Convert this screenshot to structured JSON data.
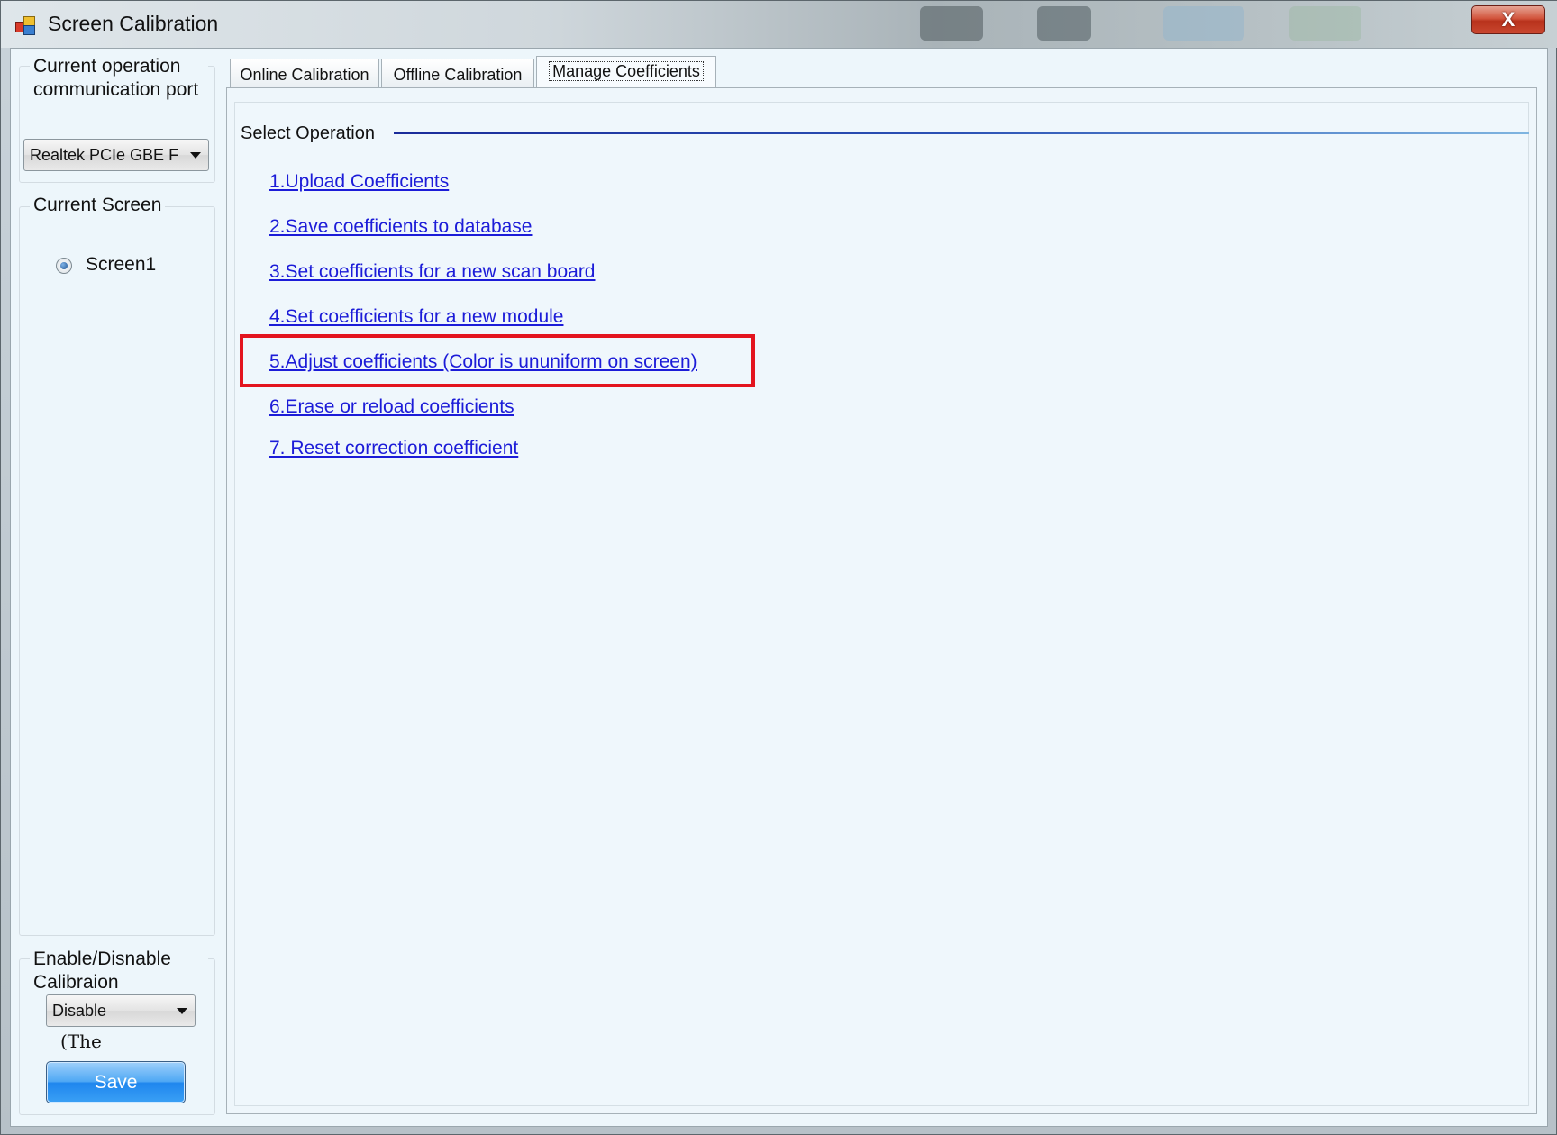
{
  "window": {
    "title": "Screen Calibration",
    "close_label": "X"
  },
  "sidebar": {
    "port_group_title": "Current operation communication port",
    "port_selected": "Realtek PCIe GBE F",
    "screen_group_title": "Current Screen",
    "screens": [
      {
        "label": "Screen1",
        "selected": true
      }
    ],
    "calibration_group_title": "Enable/Disnable Calibraion",
    "calibration_selected": "Disable",
    "note_text": "(The",
    "save_label": "Save"
  },
  "tabs": [
    {
      "label": "Online Calibration",
      "active": false
    },
    {
      "label": "Offline Calibration",
      "active": false
    },
    {
      "label": "Manage Coefficients",
      "active": true
    }
  ],
  "main": {
    "section_title": "Select Operation",
    "operations": [
      {
        "label": "1.Upload Coefficients"
      },
      {
        "label": "2.Save coefficients to database"
      },
      {
        "label": "3.Set coefficients for a new scan board"
      },
      {
        "label": "4.Set coefficients for a new module"
      },
      {
        "label": "5.Adjust coefficients (Color is ununiform on screen)",
        "highlighted": true
      },
      {
        "label": "6.Erase or reload coefficients"
      },
      {
        "label": "7. Reset correction coefficient"
      }
    ]
  },
  "colors": {
    "link": "#1c1cd8",
    "highlight_border": "#e3141e",
    "save_button": "#1f86ee"
  }
}
